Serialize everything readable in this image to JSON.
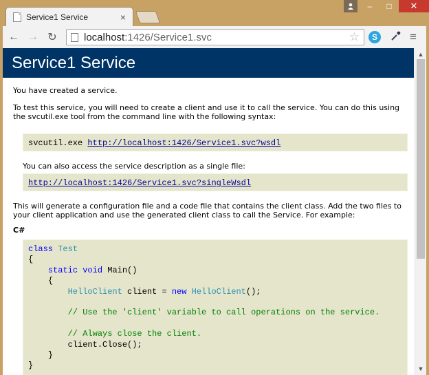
{
  "tab": {
    "title": "Service1 Service",
    "close": "×"
  },
  "window": {
    "minimize": "–",
    "maximize": "□",
    "close": "✕"
  },
  "toolbar": {
    "back": "←",
    "forward": "→",
    "reload": "↻",
    "url_host": "localhost",
    "url_path": ":1426/Service1.svc",
    "star": "☆",
    "skype": "S",
    "menu": "≡"
  },
  "page": {
    "title": "Service1 Service",
    "created": "You have created a service.",
    "instructions": "To test this service, you will need to create a client and use it to call the service. You can do this using the svcutil.exe tool from the command line with the following syntax:",
    "svcutil_cmd": "svcutil.exe ",
    "wsdl_link": "http://localhost:1426/Service1.svc?wsdl",
    "single_file_text": "You can also access the service description as a single file:",
    "single_wsdl_link": "http://localhost:1426/Service1.svc?singleWsdl",
    "generate_text": "This will generate a configuration file and a code file that contains the client class. Add the two files to your client application and use the generated client class to call the Service. For example:",
    "language_label": "C#"
  },
  "code": {
    "kw_class": "class",
    "class_name": "Test",
    "brace_open": "{",
    "kw_static": "static",
    "kw_void": "void",
    "main": "Main()",
    "inner_open": "{",
    "client_type": "HelloClient",
    "client_decl": " client = ",
    "kw_new": "new",
    "client_ctor": "HelloClient",
    "ctor_end": "();",
    "comment1": "// Use the 'client' variable to call operations on the service.",
    "comment2": "// Always close the client.",
    "close_call": "client.Close();",
    "inner_close": "}",
    "brace_close": "}"
  }
}
